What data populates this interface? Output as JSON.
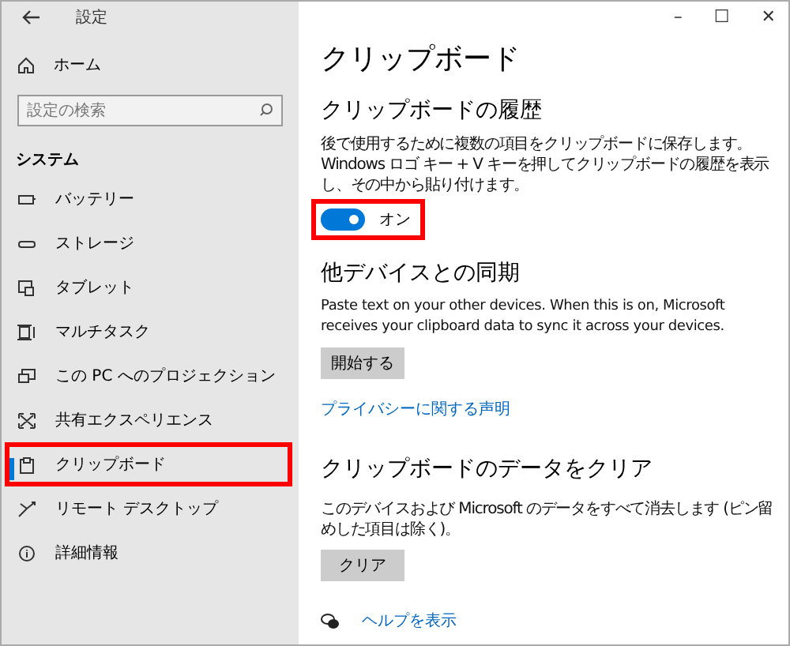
{
  "window": {
    "title": "設定",
    "controls": [
      "–",
      "☐",
      "✕"
    ]
  },
  "sidebar": {
    "home": "ホーム",
    "search": {
      "placeholder": "設定の検索"
    },
    "section": "システム",
    "items": [
      {
        "kind": "battery",
        "label": "バッテリー",
        "selected": false,
        "highlighted": false
      },
      {
        "kind": "storage",
        "label": "ストレージ",
        "selected": false,
        "highlighted": false
      },
      {
        "kind": "tablet",
        "label": "タブレット",
        "selected": false,
        "highlighted": false
      },
      {
        "kind": "multitask",
        "label": "マルチタスク",
        "selected": false,
        "highlighted": false
      },
      {
        "kind": "projection",
        "label": "この PC へのプロジェクション",
        "selected": false,
        "highlighted": false
      },
      {
        "kind": "shared",
        "label": "共有エクスペリエンス",
        "selected": false,
        "highlighted": false
      },
      {
        "kind": "clipboard",
        "label": "クリップボード",
        "selected": true,
        "highlighted": true
      },
      {
        "kind": "remote",
        "label": "リモート デスクトップ",
        "selected": false,
        "highlighted": false
      },
      {
        "kind": "info",
        "label": "詳細情報",
        "selected": false,
        "highlighted": false
      }
    ]
  },
  "page": {
    "title": "クリップボード",
    "history": {
      "heading": "クリップボードの履歴",
      "description": "後で使用するために複数の項目をクリップボードに保存します。Windows ロゴ キー + V キーを押してクリップボードの履歴を表示し、その中から貼り付けます。",
      "toggle": {
        "on": true,
        "label": "オン",
        "highlighted": true
      }
    },
    "sync": {
      "heading": "他デバイスとの同期",
      "description": "Paste text on your other devices. When this is on, Microsoft receives your clipboard data to sync it across your devices.",
      "button": "開始する",
      "link": "プライバシーに関する声明"
    },
    "clear": {
      "heading": "クリップボードのデータをクリア",
      "description": "このデバイスおよび Microsoft のデータをすべて消去します (ピン留めした項目は除く)。",
      "button": "クリア"
    },
    "help": "ヘルプを表示"
  }
}
